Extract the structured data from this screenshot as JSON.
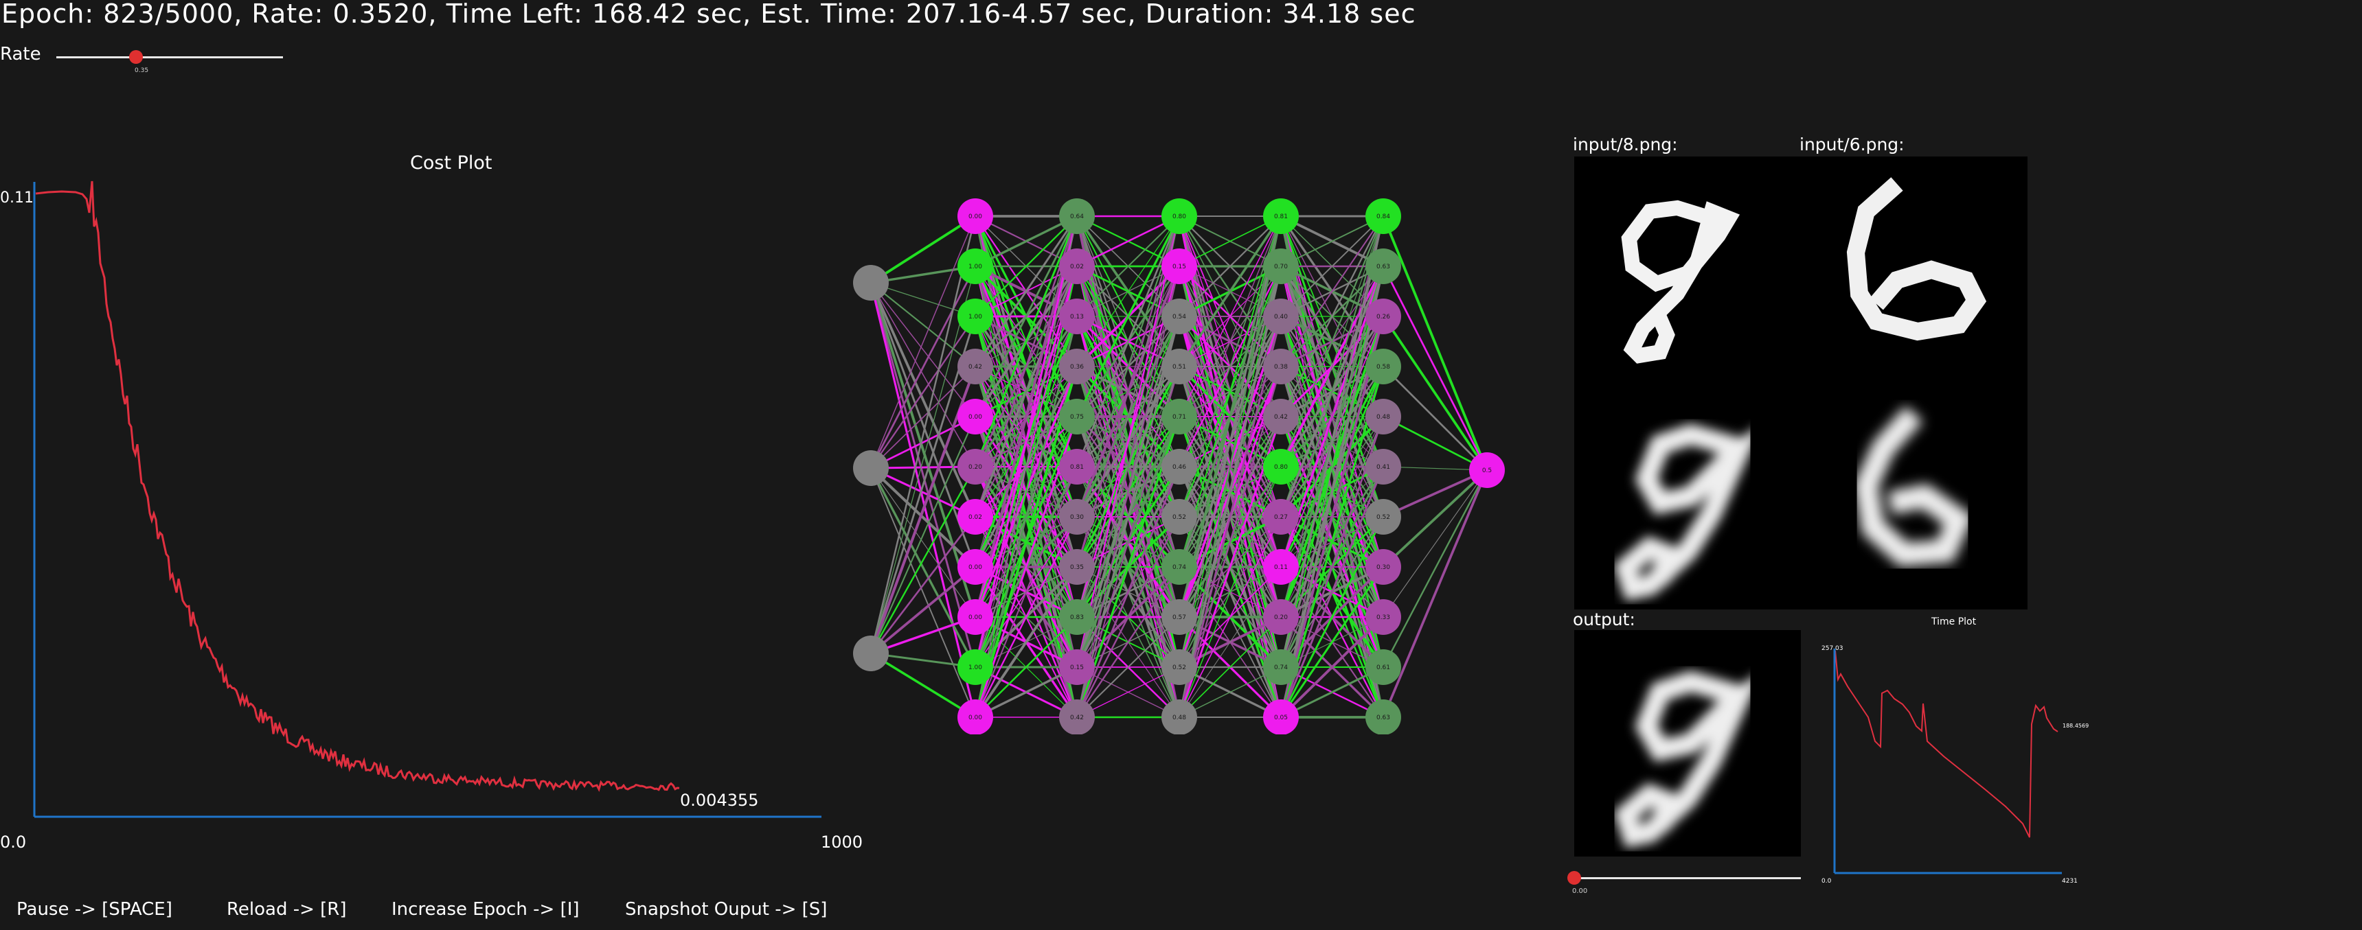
{
  "header": {
    "status": "Epoch: 823/5000, Rate: 0.3520, Time Left: 168.42 sec, Est. Time: 207.16-4.57 sec, Duration: 34.18 sec",
    "rate_label": "Rate",
    "rate_value": "0.35",
    "rate_fraction": 0.35
  },
  "cost_plot": {
    "title": "Cost Plot",
    "ymax_label": "0.11",
    "xmin_label": "0.0",
    "xmax_label": "1000",
    "last_value_label": "0.004355"
  },
  "network": {
    "layers": [
      {
        "nodes": [
          {
            "v": "",
            "c": "gray"
          },
          {
            "v": "",
            "c": "gray"
          },
          {
            "v": "",
            "c": "gray"
          }
        ]
      },
      {
        "nodes": [
          {
            "v": "0.00",
            "c": "magenta"
          },
          {
            "v": "1.00",
            "c": "green"
          },
          {
            "v": "1.00",
            "c": "green"
          },
          {
            "v": "0.42",
            "c": "mgray"
          },
          {
            "v": "0.00",
            "c": "magenta"
          },
          {
            "v": "0.20",
            "c": "mauve"
          },
          {
            "v": "0.02",
            "c": "magenta"
          },
          {
            "v": "0.00",
            "c": "magenta"
          },
          {
            "v": "0.00",
            "c": "magenta"
          },
          {
            "v": "1.00",
            "c": "green"
          },
          {
            "v": "0.00",
            "c": "magenta"
          }
        ]
      },
      {
        "nodes": [
          {
            "v": "0.64",
            "c": "dgreen"
          },
          {
            "v": "0.02",
            "c": "mauve"
          },
          {
            "v": "0.13",
            "c": "mauve"
          },
          {
            "v": "0.36",
            "c": "mgray"
          },
          {
            "v": "0.75",
            "c": "dgreen"
          },
          {
            "v": "0.81",
            "c": "mauve"
          },
          {
            "v": "0.30",
            "c": "mgray"
          },
          {
            "v": "0.35",
            "c": "mgray"
          },
          {
            "v": "0.83",
            "c": "dgreen"
          },
          {
            "v": "0.15",
            "c": "mauve"
          },
          {
            "v": "0.42",
            "c": "mgray"
          }
        ]
      },
      {
        "nodes": [
          {
            "v": "0.80",
            "c": "green"
          },
          {
            "v": "0.15",
            "c": "magenta"
          },
          {
            "v": "0.54",
            "c": "gray"
          },
          {
            "v": "0.51",
            "c": "gray"
          },
          {
            "v": "0.71",
            "c": "dgreen"
          },
          {
            "v": "0.46",
            "c": "gray"
          },
          {
            "v": "0.52",
            "c": "gray"
          },
          {
            "v": "0.74",
            "c": "dgreen"
          },
          {
            "v": "0.57",
            "c": "gray"
          },
          {
            "v": "0.52",
            "c": "gray"
          },
          {
            "v": "0.48",
            "c": "gray"
          }
        ]
      },
      {
        "nodes": [
          {
            "v": "0.81",
            "c": "green"
          },
          {
            "v": "0.70",
            "c": "dgreen"
          },
          {
            "v": "0.40",
            "c": "mgray"
          },
          {
            "v": "0.38",
            "c": "mgray"
          },
          {
            "v": "0.42",
            "c": "mgray"
          },
          {
            "v": "0.80",
            "c": "green"
          },
          {
            "v": "0.27",
            "c": "mauve"
          },
          {
            "v": "0.11",
            "c": "magenta"
          },
          {
            "v": "0.20",
            "c": "mauve"
          },
          {
            "v": "0.74",
            "c": "dgreen"
          },
          {
            "v": "0.05",
            "c": "magenta"
          }
        ]
      },
      {
        "nodes": [
          {
            "v": "0.84",
            "c": "green"
          },
          {
            "v": "0.63",
            "c": "dgreen"
          },
          {
            "v": "0.26",
            "c": "mauve"
          },
          {
            "v": "0.58",
            "c": "dgreen"
          },
          {
            "v": "0.48",
            "c": "mgray"
          },
          {
            "v": "0.41",
            "c": "mgray"
          },
          {
            "v": "0.52",
            "c": "gray"
          },
          {
            "v": "0.30",
            "c": "mauve"
          },
          {
            "v": "0.33",
            "c": "mauve"
          },
          {
            "v": "0.61",
            "c": "dgreen"
          },
          {
            "v": "0.63",
            "c": "dgreen"
          }
        ]
      },
      {
        "nodes": [
          {
            "v": "0.5",
            "c": "magenta"
          }
        ]
      }
    ],
    "palette": {
      "magenta": "#ee1cee",
      "green": "#22e022",
      "dgreen": "#58955a",
      "gray": "#808080",
      "mgray": "#8a6a8a",
      "mauve": "#a64aa6"
    }
  },
  "images": {
    "input1_label": "input/8.png:",
    "input2_label": "input/6.png:",
    "output_label": "output:",
    "output_slider_value": "0.00",
    "output_slider_fraction": 0.0
  },
  "time_plot": {
    "title": "Time Plot",
    "ymax_label": "257.03",
    "xmin_label": "0.0",
    "xmax_label": "4231",
    "last_value_label": "188.4569"
  },
  "controls": {
    "pause": "Pause -> [SPACE]",
    "reload": "Reload -> [R]",
    "increase_epoch": "Increase Epoch -> [I]",
    "snapshot": "Snapshot Ouput -> [S]"
  },
  "colors": {
    "background": "#181818",
    "plot_line": "#e03040",
    "axis": "#1f74c8",
    "slider_knob": "#e03030"
  }
}
